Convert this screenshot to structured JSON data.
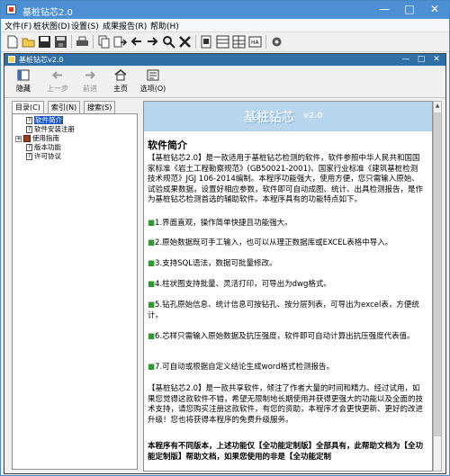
{
  "app": {
    "title": "基桩钻芯2.0"
  },
  "menu": [
    "文件(F)",
    "桩状图(D)",
    "设置(S)",
    "成果报告(R)",
    "帮助(H)"
  ],
  "toolbar_icons": [
    "new-file-icon",
    "open-folder-icon",
    "save-icon",
    "save-as-icon",
    "print-icon",
    "copy-icon",
    "import-icon",
    "back-arrow-icon",
    "forward-arrow-icon",
    "search-icon",
    "delete-icon",
    "page-icon",
    "table-icon",
    "grid-icon",
    "report-icon",
    "settings-icon"
  ],
  "help": {
    "title": "基桩钻芯v2.0",
    "buttons": {
      "hide": "隐藏",
      "back": "上一步",
      "forward": "前进",
      "home": "主页",
      "options": "选项(O)"
    },
    "tabs": {
      "contents": "目录(C)",
      "index": "索引(N)",
      "search": "搜索(S)"
    },
    "tree": [
      "软件简介",
      "软件安装注册",
      "使用指南",
      "版本功能",
      "许可协议"
    ]
  },
  "doc": {
    "banner_title": "基桩钻芯",
    "banner_version": "v2.0",
    "heading": "软件简介",
    "intro": "【基桩钻芯2.0】是一款适用于基桩钻芯检测的软件，软件参照中华人民共和国国家标准《岩土工程勘察规范》(GB50021-2001)、国家行业标准《建筑基桩检测技术规范》JGJ 106-2014编制。本程序功能强大，使用方便，您只需输入原始、试验成果数据，设置好相应参数，软件即可自动成图、统计、出具检测报告，是作为基桩钻芯检测首选的辅助软件。本程序具有的功能特点如下。",
    "features": [
      "1.界面直观，操作简单快捷且功能强大。",
      "2.原始数据既可手工输入，也可以从理正数据库或EXCEL表格中导入。",
      "3.支持SQL语法，数据可批量修改。",
      "4.柱状图支持批量、灵活打印，可导出为dwg格式。",
      "5.钻孔原始信息、统计信息可按钻孔、按分层列表，可导出为excel表，方便统计。",
      "6.芯样只需输入原始数据及抗压强度，软件即可自动计算出抗压强度代表值。",
      "7.可自动或根据自定义结论生成word格式检测报告。"
    ],
    "closing": "【基桩钻芯2.0】是一款共享软件，倾注了作者大量的时间和精力。经过试用，如果您觉得这款软件不错，希望无限制地长期使用并获得更强大的功能以及全面的技术支持，请您购买注册这款软件，有您的资助，本程序才会更快更新、更好的改进升级！您也将获得本程序的免费升级服务。",
    "bold_tail": "本程序有不同版本，上述功能仅【全功能定制版】全部具有，此帮助文档为【全功能定制版】帮助文档，如果您使用的非是【全功能定制"
  },
  "colors": {
    "title_bar": "#4c8fd2",
    "help_title_bar": "#2f6fa5",
    "feature_mark": "#2d9b2d",
    "selection": "#1a57c5"
  }
}
